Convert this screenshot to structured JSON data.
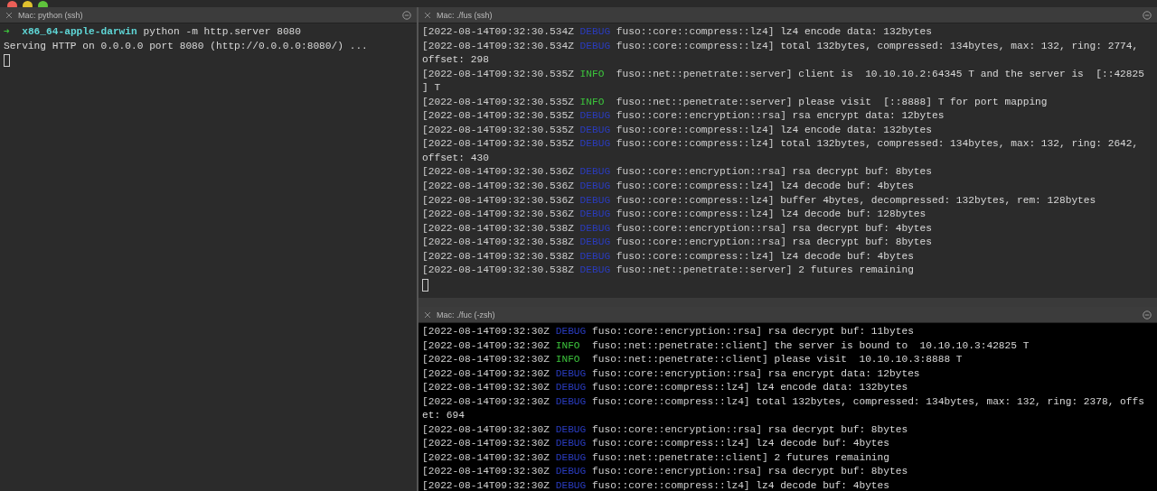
{
  "panes": [
    {
      "title": "Mac: python (ssh)",
      "focused": false,
      "lines": [
        {
          "kind": "prompt",
          "arrow": "➜",
          "host": "x86_64-apple-darwin",
          "command": "python -m http.server 8080"
        },
        {
          "kind": "output",
          "text": "Serving HTTP on 0.0.0.0 port 8080 (http://0.0.0.0:8080/) ..."
        }
      ]
    },
    {
      "title": "Mac: ./fus (ssh)",
      "focused": false,
      "lines": [
        {
          "kind": "log",
          "timestamp": "[2022-08-14T09:32:30.534Z",
          "level": "DEBUG",
          "color": "#2a3cc0",
          "target": "fuso::core::compress::lz4]",
          "message": "lz4 encode data: 132bytes"
        },
        {
          "kind": "log",
          "timestamp": "[2022-08-14T09:32:30.534Z",
          "level": "DEBUG",
          "color": "#2a3cc0",
          "target": "fuso::core::compress::lz4]",
          "message": "total 132bytes, compressed: 134bytes, max: 132, ring: 2774, offset: 298"
        },
        {
          "kind": "log",
          "timestamp": "[2022-08-14T09:32:30.535Z",
          "level": "INFO",
          "color": "#3cc43c",
          "target": "fuso::net::penetrate::server]",
          "message": "client is  10.10.10.2:64345 T and the server is  [::42825] T"
        },
        {
          "kind": "log",
          "timestamp": "[2022-08-14T09:32:30.535Z",
          "level": "INFO",
          "color": "#3cc43c",
          "target": "fuso::net::penetrate::server]",
          "message": "please visit  [::8888] T for port mapping"
        },
        {
          "kind": "log",
          "timestamp": "[2022-08-14T09:32:30.535Z",
          "level": "DEBUG",
          "color": "#2a3cc0",
          "target": "fuso::core::encryption::rsa]",
          "message": "rsa encrypt data: 12bytes"
        },
        {
          "kind": "log",
          "timestamp": "[2022-08-14T09:32:30.535Z",
          "level": "DEBUG",
          "color": "#2a3cc0",
          "target": "fuso::core::compress::lz4]",
          "message": "lz4 encode data: 132bytes"
        },
        {
          "kind": "log",
          "timestamp": "[2022-08-14T09:32:30.535Z",
          "level": "DEBUG",
          "color": "#2a3cc0",
          "target": "fuso::core::compress::lz4]",
          "message": "total 132bytes, compressed: 134bytes, max: 132, ring: 2642, offset: 430"
        },
        {
          "kind": "log",
          "timestamp": "[2022-08-14T09:32:30.536Z",
          "level": "DEBUG",
          "color": "#2a3cc0",
          "target": "fuso::core::encryption::rsa]",
          "message": "rsa decrypt buf: 8bytes"
        },
        {
          "kind": "log",
          "timestamp": "[2022-08-14T09:32:30.536Z",
          "level": "DEBUG",
          "color": "#2a3cc0",
          "target": "fuso::core::compress::lz4]",
          "message": "lz4 decode buf: 4bytes"
        },
        {
          "kind": "log",
          "timestamp": "[2022-08-14T09:32:30.536Z",
          "level": "DEBUG",
          "color": "#2a3cc0",
          "target": "fuso::core::compress::lz4]",
          "message": "buffer 4bytes, decompressed: 132bytes, rem: 128bytes"
        },
        {
          "kind": "log",
          "timestamp": "[2022-08-14T09:32:30.536Z",
          "level": "DEBUG",
          "color": "#2a3cc0",
          "target": "fuso::core::compress::lz4]",
          "message": "lz4 decode buf: 128bytes"
        },
        {
          "kind": "log",
          "timestamp": "[2022-08-14T09:32:30.538Z",
          "level": "DEBUG",
          "color": "#2a3cc0",
          "target": "fuso::core::encryption::rsa]",
          "message": "rsa decrypt buf: 4bytes"
        },
        {
          "kind": "log",
          "timestamp": "[2022-08-14T09:32:30.538Z",
          "level": "DEBUG",
          "color": "#2a3cc0",
          "target": "fuso::core::encryption::rsa]",
          "message": "rsa decrypt buf: 8bytes"
        },
        {
          "kind": "log",
          "timestamp": "[2022-08-14T09:32:30.538Z",
          "level": "DEBUG",
          "color": "#2a3cc0",
          "target": "fuso::core::compress::lz4]",
          "message": "lz4 decode buf: 4bytes"
        },
        {
          "kind": "log",
          "timestamp": "[2022-08-14T09:32:30.538Z",
          "level": "DEBUG",
          "color": "#2a3cc0",
          "target": "fuso::net::penetrate::server]",
          "message": "2 futures remaining"
        }
      ]
    },
    {
      "title": "Mac: ./fuc (-zsh)",
      "focused": true,
      "lines": [
        {
          "kind": "log",
          "timestamp": "[2022-08-14T09:32:30Z",
          "level": "DEBUG",
          "color": "#2a3cc0",
          "target": "fuso::core::encryption::rsa]",
          "message": "rsa decrypt buf: 11bytes"
        },
        {
          "kind": "log",
          "timestamp": "[2022-08-14T09:32:30Z",
          "level": "INFO",
          "color": "#3cc43c",
          "target": "fuso::net::penetrate::client]",
          "message": "the server is bound to  10.10.10.3:42825 T"
        },
        {
          "kind": "log",
          "timestamp": "[2022-08-14T09:32:30Z",
          "level": "INFO",
          "color": "#3cc43c",
          "target": "fuso::net::penetrate::client]",
          "message": "please visit  10.10.10.3:8888 T"
        },
        {
          "kind": "log",
          "timestamp": "[2022-08-14T09:32:30Z",
          "level": "DEBUG",
          "color": "#2a3cc0",
          "target": "fuso::core::encryption::rsa]",
          "message": "rsa encrypt data: 12bytes"
        },
        {
          "kind": "log",
          "timestamp": "[2022-08-14T09:32:30Z",
          "level": "DEBUG",
          "color": "#2a3cc0",
          "target": "fuso::core::compress::lz4]",
          "message": "lz4 encode data: 132bytes"
        },
        {
          "kind": "log",
          "timestamp": "[2022-08-14T09:32:30Z",
          "level": "DEBUG",
          "color": "#2a3cc0",
          "target": "fuso::core::compress::lz4]",
          "message": "total 132bytes, compressed: 134bytes, max: 132, ring: 2378, offset: 694"
        },
        {
          "kind": "log",
          "timestamp": "[2022-08-14T09:32:30Z",
          "level": "DEBUG",
          "color": "#2a3cc0",
          "target": "fuso::core::encryption::rsa]",
          "message": "rsa decrypt buf: 8bytes"
        },
        {
          "kind": "log",
          "timestamp": "[2022-08-14T09:32:30Z",
          "level": "DEBUG",
          "color": "#2a3cc0",
          "target": "fuso::core::compress::lz4]",
          "message": "lz4 decode buf: 4bytes"
        },
        {
          "kind": "log",
          "timestamp": "[2022-08-14T09:32:30Z",
          "level": "DEBUG",
          "color": "#2a3cc0",
          "target": "fuso::net::penetrate::client]",
          "message": "2 futures remaining"
        },
        {
          "kind": "log",
          "timestamp": "[2022-08-14T09:32:30Z",
          "level": "DEBUG",
          "color": "#2a3cc0",
          "target": "fuso::core::encryption::rsa]",
          "message": "rsa decrypt buf: 8bytes"
        },
        {
          "kind": "log",
          "timestamp": "[2022-08-14T09:32:30Z",
          "level": "DEBUG",
          "color": "#2a3cc0",
          "target": "fuso::core::compress::lz4]",
          "message": "lz4 decode buf: 4bytes"
        }
      ]
    }
  ]
}
